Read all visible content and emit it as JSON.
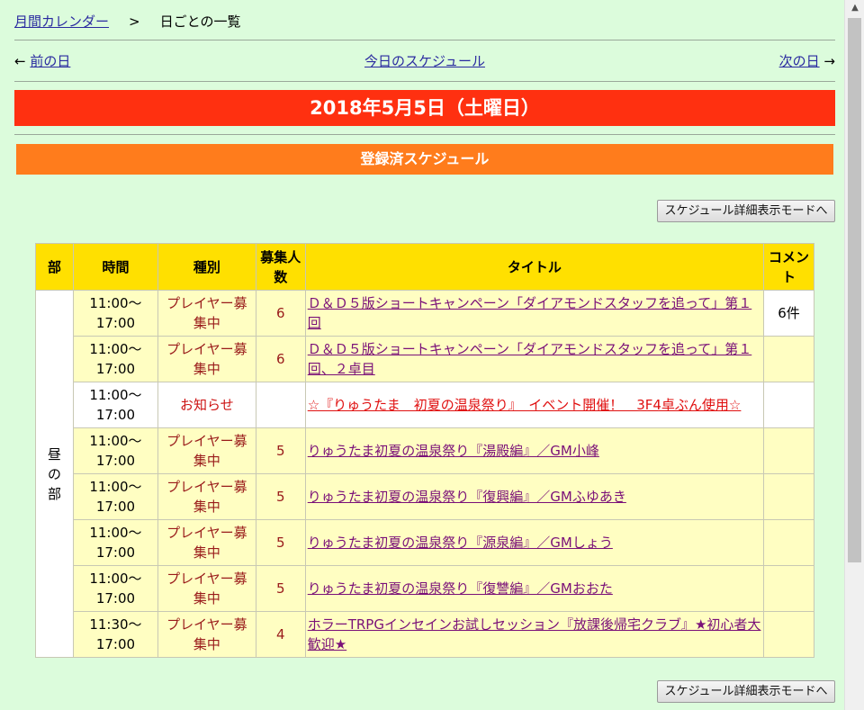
{
  "breadcrumb": {
    "home": "月間カレンダー",
    "separator": ">",
    "current": "日ごとの一覧"
  },
  "daynav": {
    "prev_arrow": "←",
    "prev": "前の日",
    "today": "今日のスケジュール",
    "next": "次の日",
    "next_arrow": "→"
  },
  "date_banner": "2018年5月5日（土曜日）",
  "section_title": "登録済スケジュール",
  "mode_button": "スケジュール詳細表示モードへ",
  "table": {
    "headers": [
      "部",
      "時間",
      "種別",
      "募集人数",
      "タイトル",
      "コメント"
    ],
    "period": "昼の部",
    "rows": [
      {
        "time": "11:00〜17:00",
        "type": "プレイヤー募集中",
        "count": "6",
        "title": "Ｄ＆Ｄ５版ショートキャンペーン「ダイアモンドスタッフを追って」第１回",
        "comment": "6件"
      },
      {
        "time": "11:00〜17:00",
        "type": "プレイヤー募集中",
        "count": "6",
        "title": "Ｄ＆Ｄ５版ショートキャンペーン「ダイアモンドスタッフを追って」第１回、２卓目",
        "comment": ""
      },
      {
        "time": "11:00〜17:00",
        "type": "お知らせ",
        "count": "",
        "title": "☆『りゅうたま　初夏の温泉祭り』　イベント開催！　3F4卓ぶん使用☆",
        "comment": ""
      },
      {
        "time": "11:00〜17:00",
        "type": "プレイヤー募集中",
        "count": "5",
        "title": "りゅうたま初夏の温泉祭り『湯殿編』／GM小峰",
        "comment": ""
      },
      {
        "time": "11:00〜17:00",
        "type": "プレイヤー募集中",
        "count": "5",
        "title": "りゅうたま初夏の温泉祭り『復興編』／GMふゆあき",
        "comment": ""
      },
      {
        "time": "11:00〜17:00",
        "type": "プレイヤー募集中",
        "count": "5",
        "title": "りゅうたま初夏の温泉祭り『源泉編』／GMしょう",
        "comment": ""
      },
      {
        "time": "11:00〜17:00",
        "type": "プレイヤー募集中",
        "count": "5",
        "title": "りゅうたま初夏の温泉祭り『復讐編』／GMおおた",
        "comment": ""
      },
      {
        "time": "11:30〜17:00",
        "type": "プレイヤー募集中",
        "count": "4",
        "title": "ホラーTRPGインセインお試しセッション『放課後帰宅クラブ』★初心者大歓迎★",
        "comment": ""
      }
    ]
  },
  "colors": {
    "background": "#dcfcdc",
    "date_banner": "#ff3010",
    "section_banner": "#ff7c1c",
    "table_header": "#ffe000",
    "table_row": "#fffec2",
    "link": "#2a2aa0"
  }
}
